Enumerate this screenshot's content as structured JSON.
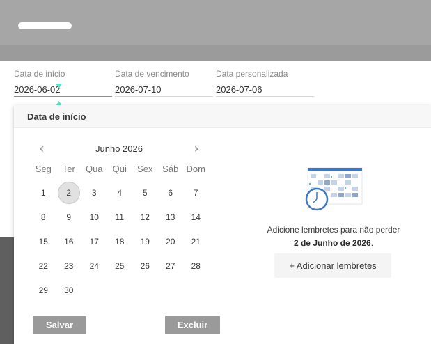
{
  "header": {
    "logo_placeholder": ""
  },
  "fields": [
    {
      "label": "Data de início",
      "value": "2026-06-02"
    },
    {
      "label": "Data de vencimento",
      "value": "2026-07-10"
    },
    {
      "label": "Data personalizada",
      "value": "2026-07-06"
    }
  ],
  "popup": {
    "title": "Data de início",
    "calendar": {
      "month_label": "Junho 2026",
      "prev_icon": "chevron-left-icon",
      "next_icon": "chevron-right-icon",
      "weekdays": [
        "Seg",
        "Ter",
        "Qua",
        "Qui",
        "Sex",
        "Sáb",
        "Dom"
      ],
      "days": [
        "1",
        "2",
        "3",
        "4",
        "5",
        "6",
        "7",
        "8",
        "9",
        "10",
        "11",
        "12",
        "13",
        "14",
        "15",
        "16",
        "17",
        "18",
        "19",
        "20",
        "21",
        "22",
        "23",
        "24",
        "25",
        "26",
        "27",
        "28",
        "29",
        "30"
      ],
      "selected_day": "2"
    },
    "save_label": "Salvar",
    "delete_label": "Excluir",
    "reminder": {
      "text_before": "Adicione lembretes para não perder ",
      "date_bold": "2 de Junho de 2026",
      "text_after": ".",
      "add_label": "+ Adicionar lembretes",
      "icon": "calendar-clock-icon"
    }
  },
  "colors": {
    "header": "#a6a6a6",
    "button_gray": "#9a9a9a",
    "accent_blue": "#3d78c4",
    "caret_teal": "#5fe0c8"
  }
}
